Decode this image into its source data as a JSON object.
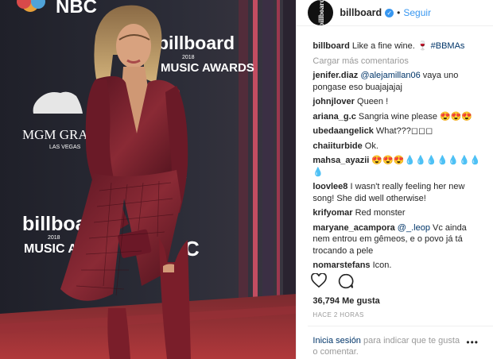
{
  "header": {
    "username": "billboard",
    "avatar_text": "billboard",
    "separator": "•",
    "follow_label": "Seguir"
  },
  "photo": {
    "backdrop_texts": [
      "NBC",
      "billboard",
      "2018",
      "MUSIC AWARDS",
      "MGM GRAN",
      "LAS VEGAS",
      "billboard",
      "2018",
      "MUSIC AWA",
      "C",
      "k",
      "C"
    ]
  },
  "caption": {
    "user": "billboard",
    "text": "Like a fine wine. 🍷 ",
    "hashtag": "#BBMAs"
  },
  "load_more": "Cargar más comentarios",
  "comments": [
    {
      "user": "jenifer.diaz",
      "mention": "@alejamillan06",
      "text": " vaya uno pongase eso buajajajaj"
    },
    {
      "user": "johnjlover",
      "mention": "",
      "text": "Queen !"
    },
    {
      "user": "ariana_g.c",
      "mention": "",
      "text": "Sangria wine please 😍😍😍"
    },
    {
      "user": "ubedaangelick",
      "mention": "",
      "text": "What???◻◻◻"
    },
    {
      "user": "chaiiturbide",
      "mention": "",
      "text": "Ok."
    },
    {
      "user": "mahsa_ayazii",
      "mention": "",
      "text": "😍😍😍💧💧💧💧💧💧💧💧"
    },
    {
      "user": "loovlee8",
      "mention": "",
      "text": "I wasn't really feeling her new song! She did well otherwise!"
    },
    {
      "user": "krifyomar",
      "mention": "",
      "text": "Red monster"
    },
    {
      "user": "maryane_acampora",
      "mention": "@_.leop",
      "text": " Vc ainda nem entrou em gêmeos, e o povo já tá trocando a pele"
    },
    {
      "user": "nomarstefans",
      "mention": "",
      "text": "Icon."
    }
  ],
  "likes": {
    "count": "36,794",
    "label": "Me gusta"
  },
  "timestamp": "HACE 2 HORAS",
  "login": {
    "link": "Inicia sesión",
    "text": " para indicar que te gusta o comentar."
  },
  "more_options": "•••",
  "icons": [
    "heart-icon",
    "comment-icon",
    "verified-badge-icon",
    "more-options-icon"
  ],
  "colors": {
    "link": "#003569",
    "follow": "#3897f0",
    "muted": "#999999",
    "text": "#262626"
  }
}
